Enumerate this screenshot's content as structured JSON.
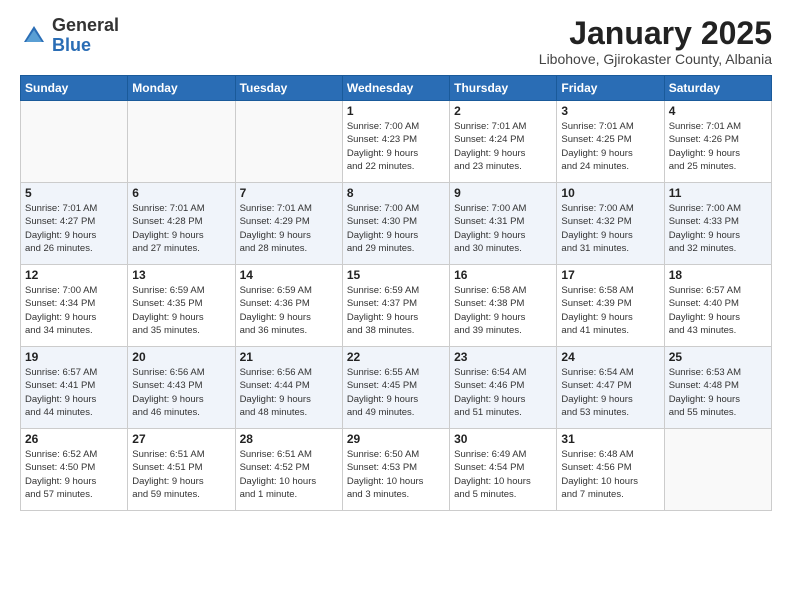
{
  "header": {
    "logo_general": "General",
    "logo_blue": "Blue",
    "month_title": "January 2025",
    "subtitle": "Libohove, Gjirokaster County, Albania"
  },
  "weekdays": [
    "Sunday",
    "Monday",
    "Tuesday",
    "Wednesday",
    "Thursday",
    "Friday",
    "Saturday"
  ],
  "weeks": [
    [
      {
        "day": "",
        "info": ""
      },
      {
        "day": "",
        "info": ""
      },
      {
        "day": "",
        "info": ""
      },
      {
        "day": "1",
        "info": "Sunrise: 7:00 AM\nSunset: 4:23 PM\nDaylight: 9 hours\nand 22 minutes."
      },
      {
        "day": "2",
        "info": "Sunrise: 7:01 AM\nSunset: 4:24 PM\nDaylight: 9 hours\nand 23 minutes."
      },
      {
        "day": "3",
        "info": "Sunrise: 7:01 AM\nSunset: 4:25 PM\nDaylight: 9 hours\nand 24 minutes."
      },
      {
        "day": "4",
        "info": "Sunrise: 7:01 AM\nSunset: 4:26 PM\nDaylight: 9 hours\nand 25 minutes."
      }
    ],
    [
      {
        "day": "5",
        "info": "Sunrise: 7:01 AM\nSunset: 4:27 PM\nDaylight: 9 hours\nand 26 minutes."
      },
      {
        "day": "6",
        "info": "Sunrise: 7:01 AM\nSunset: 4:28 PM\nDaylight: 9 hours\nand 27 minutes."
      },
      {
        "day": "7",
        "info": "Sunrise: 7:01 AM\nSunset: 4:29 PM\nDaylight: 9 hours\nand 28 minutes."
      },
      {
        "day": "8",
        "info": "Sunrise: 7:00 AM\nSunset: 4:30 PM\nDaylight: 9 hours\nand 29 minutes."
      },
      {
        "day": "9",
        "info": "Sunrise: 7:00 AM\nSunset: 4:31 PM\nDaylight: 9 hours\nand 30 minutes."
      },
      {
        "day": "10",
        "info": "Sunrise: 7:00 AM\nSunset: 4:32 PM\nDaylight: 9 hours\nand 31 minutes."
      },
      {
        "day": "11",
        "info": "Sunrise: 7:00 AM\nSunset: 4:33 PM\nDaylight: 9 hours\nand 32 minutes."
      }
    ],
    [
      {
        "day": "12",
        "info": "Sunrise: 7:00 AM\nSunset: 4:34 PM\nDaylight: 9 hours\nand 34 minutes."
      },
      {
        "day": "13",
        "info": "Sunrise: 6:59 AM\nSunset: 4:35 PM\nDaylight: 9 hours\nand 35 minutes."
      },
      {
        "day": "14",
        "info": "Sunrise: 6:59 AM\nSunset: 4:36 PM\nDaylight: 9 hours\nand 36 minutes."
      },
      {
        "day": "15",
        "info": "Sunrise: 6:59 AM\nSunset: 4:37 PM\nDaylight: 9 hours\nand 38 minutes."
      },
      {
        "day": "16",
        "info": "Sunrise: 6:58 AM\nSunset: 4:38 PM\nDaylight: 9 hours\nand 39 minutes."
      },
      {
        "day": "17",
        "info": "Sunrise: 6:58 AM\nSunset: 4:39 PM\nDaylight: 9 hours\nand 41 minutes."
      },
      {
        "day": "18",
        "info": "Sunrise: 6:57 AM\nSunset: 4:40 PM\nDaylight: 9 hours\nand 43 minutes."
      }
    ],
    [
      {
        "day": "19",
        "info": "Sunrise: 6:57 AM\nSunset: 4:41 PM\nDaylight: 9 hours\nand 44 minutes."
      },
      {
        "day": "20",
        "info": "Sunrise: 6:56 AM\nSunset: 4:43 PM\nDaylight: 9 hours\nand 46 minutes."
      },
      {
        "day": "21",
        "info": "Sunrise: 6:56 AM\nSunset: 4:44 PM\nDaylight: 9 hours\nand 48 minutes."
      },
      {
        "day": "22",
        "info": "Sunrise: 6:55 AM\nSunset: 4:45 PM\nDaylight: 9 hours\nand 49 minutes."
      },
      {
        "day": "23",
        "info": "Sunrise: 6:54 AM\nSunset: 4:46 PM\nDaylight: 9 hours\nand 51 minutes."
      },
      {
        "day": "24",
        "info": "Sunrise: 6:54 AM\nSunset: 4:47 PM\nDaylight: 9 hours\nand 53 minutes."
      },
      {
        "day": "25",
        "info": "Sunrise: 6:53 AM\nSunset: 4:48 PM\nDaylight: 9 hours\nand 55 minutes."
      }
    ],
    [
      {
        "day": "26",
        "info": "Sunrise: 6:52 AM\nSunset: 4:50 PM\nDaylight: 9 hours\nand 57 minutes."
      },
      {
        "day": "27",
        "info": "Sunrise: 6:51 AM\nSunset: 4:51 PM\nDaylight: 9 hours\nand 59 minutes."
      },
      {
        "day": "28",
        "info": "Sunrise: 6:51 AM\nSunset: 4:52 PM\nDaylight: 10 hours\nand 1 minute."
      },
      {
        "day": "29",
        "info": "Sunrise: 6:50 AM\nSunset: 4:53 PM\nDaylight: 10 hours\nand 3 minutes."
      },
      {
        "day": "30",
        "info": "Sunrise: 6:49 AM\nSunset: 4:54 PM\nDaylight: 10 hours\nand 5 minutes."
      },
      {
        "day": "31",
        "info": "Sunrise: 6:48 AM\nSunset: 4:56 PM\nDaylight: 10 hours\nand 7 minutes."
      },
      {
        "day": "",
        "info": ""
      }
    ]
  ]
}
